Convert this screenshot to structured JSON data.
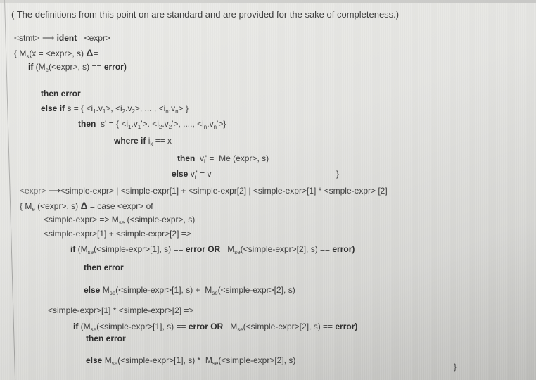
{
  "document": {
    "intro_note": "( The definitions from this point on are standard and are provided for the sake of completeness.)",
    "stmt_section": {
      "production": {
        "lhs": "<stmt>",
        "arrow": "⟶",
        "rhs_ident": "ident",
        "rhs_rest": "=<expr>"
      },
      "def_head": {
        "open": "{ ",
        "fn": "M",
        "fn_sub": "s",
        "args": "(x = <expr>, s) ",
        "delta": "Δ",
        "eq": "="
      },
      "if_line": {
        "kw": "if",
        "open": " (M",
        "sub": "e",
        "args": "(<expr>, s) == ",
        "err": "error)"
      },
      "then_error": "then error",
      "else_if": {
        "kw": "else if",
        "rest_a": " s = { <i",
        "s1": "1",
        "rest_b": ".v",
        "s2": "1",
        "rest_c": ">, <i",
        "s3": "2",
        "rest_d": ".v",
        "s4": "2",
        "rest_e": ">, ... , <i",
        "s5": "n",
        "rest_f": ".v",
        "s6": "n",
        "rest_g": "> }"
      },
      "then_s_prime": {
        "kw": "then",
        "rest_a": "  s' = { <i",
        "s1": "1",
        "rest_b": ".v",
        "s2": "1",
        "rest_c": "'>. <i",
        "s3": "2",
        "rest_d": ".v",
        "s4": "2",
        "rest_e": "'>, ...., <i",
        "s5": "n",
        "rest_f": ".v",
        "s6": "n",
        "rest_g": "'>}"
      },
      "where_if": {
        "kw": "where if",
        "rest_a": " i",
        "sub": "k",
        "rest_b": " == x"
      },
      "then_vi": {
        "kw": "then",
        "rest_a": "  v",
        "sub": "i",
        "rest_b": "' =  Me (expr>, s)"
      },
      "else_vi": {
        "kw": "else",
        "rest_a": " v",
        "sub1": "i",
        "rest_b": "' = v",
        "sub2": "i"
      },
      "close": "}"
    },
    "expr_section": {
      "production": {
        "lhs": "<expr>",
        "arrow": "⟶",
        "rhs": "<simple-expr> | <simple-expr[1] + <simple-expr[2] | <simple-expr>[1] * <smple-expr> [2]"
      },
      "def_head": {
        "open": "{ M",
        "sub": "e",
        "args": " (<expr>, s) ",
        "delta": "Δ",
        "rest": " = case <expr> of"
      },
      "case_simple": {
        "pre": "<simple-expr> => M",
        "sub": "se",
        "post": " (<simple-expr>, s)"
      },
      "case_plus": "<simple-expr>[1] + <simple-expr>[2] =>",
      "plus_if": {
        "kw": "if",
        "a": " (M",
        "sub1": "se",
        "b": "(<simple-expr>[1], s) == ",
        "err_or": "error OR",
        "c": "   M",
        "sub2": "se",
        "d": "(<simple-expr>[2], s) == ",
        "err": "error)"
      },
      "plus_then": "then error",
      "plus_else": {
        "kw": "else",
        "a": " M",
        "sub1": "se",
        "b": "(<simple-expr>[1], s) +  M",
        "sub2": "se",
        "c": "(<simple-expr>[2], s)"
      },
      "case_times": "<simple-expr>[1] * <simple-expr>[2] =>",
      "times_if": {
        "kw": "if",
        "a": " (M",
        "sub1": "se",
        "b": "(<simple-expr>[1], s) == ",
        "err_or": "error OR",
        "c": "   M",
        "sub2": "se",
        "d": "(<simple-expr>[2], s) == ",
        "err": "error)"
      },
      "times_then": "then error",
      "times_else": {
        "kw": "else",
        "a": " M",
        "sub1": "se",
        "b": "(<simple-expr>[1], s) *  M",
        "sub2": "se",
        "c": "(<simple-expr>[2], s)"
      },
      "close": "}"
    }
  }
}
